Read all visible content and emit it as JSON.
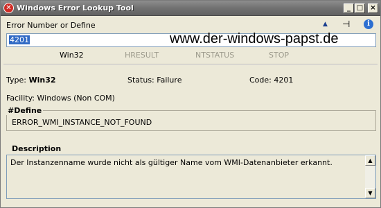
{
  "window": {
    "title": "Windows Error Lookup Tool",
    "controls": {
      "minimize": "_",
      "maximize": "□",
      "close": "×"
    }
  },
  "toolbar": {
    "label": "Error Number or Define",
    "arrow_glyph": "▲",
    "pin_glyph": "⊣",
    "info_glyph": "i"
  },
  "input": {
    "value": "4201"
  },
  "watermark": "www.der-windows-papst.de",
  "modes": [
    "Win32",
    "HRESULT",
    "NTSTATUS",
    "STOP"
  ],
  "details": {
    "type_label": "Type:",
    "type_value": "Win32",
    "status_label": "Status:",
    "status_value": "Failure",
    "code_label": "Code:",
    "code_value": "4201",
    "facility_label": "Facility:",
    "facility_value": "Windows (Non COM)"
  },
  "define": {
    "title": "#Define",
    "value": "ERROR_WMI_INSTANCE_NOT_FOUND"
  },
  "description": {
    "title": "Description",
    "text": "Der Instanzenname wurde nicht als gültiger Name vom WMI-Datenanbieter erkannt."
  },
  "scrollbar": {
    "up": "▲",
    "down": "▼"
  },
  "colors": {
    "titlebar": "#6f6f6f",
    "selection": "#316ac5",
    "disabled": "#9c9a8c"
  }
}
